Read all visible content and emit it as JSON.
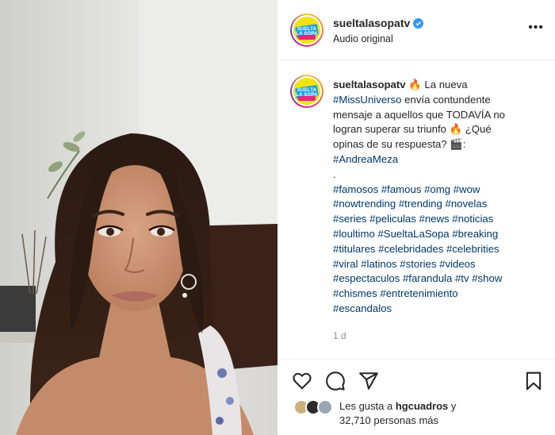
{
  "post": {
    "username": "sueltalasopatv",
    "audio_label": "Audio original",
    "avatar_logo_text": "SUELTA LA SOPA"
  },
  "caption": {
    "username": "sueltalasopatv",
    "lines": [
      {
        "parts": [
          {
            "t": " 🔥 La nueva",
            "tag": false
          }
        ]
      },
      {
        "parts": [
          {
            "t": "#MissUniverso",
            "tag": true
          },
          {
            "t": " envía contundente",
            "tag": false
          }
        ]
      },
      {
        "parts": [
          {
            "t": "mensaje a aquellos que TODAVÍA no",
            "tag": false
          }
        ]
      },
      {
        "parts": [
          {
            "t": "logran superar su triunfo 🔥 ¿Qué",
            "tag": false
          }
        ]
      },
      {
        "parts": [
          {
            "t": "opinas de su respuesta? 🎬:",
            "tag": false
          }
        ]
      },
      {
        "parts": [
          {
            "t": "#AndreaMeza",
            "tag": true
          }
        ]
      },
      {
        "parts": [
          {
            "t": ".",
            "tag": false
          }
        ]
      },
      {
        "parts": [
          {
            "t": "#famosos #famous #omg #wow",
            "tag": true
          }
        ]
      },
      {
        "parts": [
          {
            "t": "#nowtrending #trending #novelas",
            "tag": true
          }
        ]
      },
      {
        "parts": [
          {
            "t": "#series #peliculas #news #noticias",
            "tag": true
          }
        ]
      },
      {
        "parts": [
          {
            "t": "#loultimo #SueltaLaSopa #breaking",
            "tag": true
          }
        ]
      },
      {
        "parts": [
          {
            "t": "#titulares #celebridades #celebrities",
            "tag": true
          }
        ]
      },
      {
        "parts": [
          {
            "t": "#viral #latinos #stories #videos",
            "tag": true
          }
        ]
      },
      {
        "parts": [
          {
            "t": "#espectaculos #farandula #tv #show",
            "tag": true
          }
        ]
      },
      {
        "parts": [
          {
            "t": "#chismes #entretenimiento",
            "tag": true
          }
        ]
      },
      {
        "parts": [
          {
            "t": "#escandalos",
            "tag": true
          }
        ]
      }
    ],
    "time_ago": "1 d"
  },
  "likes": {
    "prefix": "Les gusta a ",
    "user": "hgcuadros",
    "suffix": " y",
    "count_line": "32,710 personas más"
  },
  "icons": {
    "heart": "heart-icon",
    "comment": "comment-icon",
    "share": "share-icon",
    "save": "bookmark-icon",
    "verified": "verified-badge-icon",
    "more": "more-options-icon"
  },
  "colors": {
    "hashtag": "#00376b",
    "verified": "#3897f0",
    "text": "#262626",
    "muted": "#8e8e8e"
  }
}
